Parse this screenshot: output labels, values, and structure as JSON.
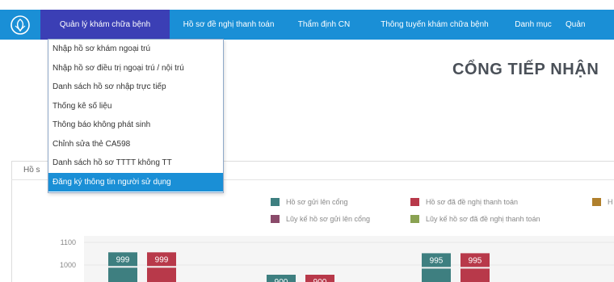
{
  "nav": {
    "items": [
      {
        "label": "Quản lý khám chữa bệnh",
        "active": true
      },
      {
        "label": "Hồ sơ đề nghị thanh toán",
        "active": false
      },
      {
        "label": "Thẩm định CN",
        "active": false
      },
      {
        "label": "Thông tuyến khám chữa bệnh",
        "active": false
      },
      {
        "label": "Danh mục",
        "active": false
      },
      {
        "label": "Quản",
        "active": false
      }
    ]
  },
  "dropdown": {
    "items": [
      {
        "label": "Nhập hồ sơ khám ngoại trú"
      },
      {
        "label": "Nhập hồ sơ điều trị ngoại trú / nội trú"
      },
      {
        "label": "Danh sách hồ sơ nhập trực tiếp"
      },
      {
        "label": "Thống kê số liệu"
      },
      {
        "label": "Thông báo không phát sinh"
      },
      {
        "label": "Chỉnh sửa thẻ CA598"
      },
      {
        "label": "Danh sách hồ sơ TTTT không TT"
      },
      {
        "label": "Đăng ký thông tin người sử dụng"
      }
    ]
  },
  "page": {
    "title": "CỔNG TIẾP NHẬN",
    "panel_tab": "Hồ s"
  },
  "chart_data": {
    "type": "bar",
    "legend": [
      {
        "name": "Hồ sơ gửi lên cổng",
        "color": "#3e7f80"
      },
      {
        "name": "Hồ sơ đã đề nghị thanh toán",
        "color": "#b8394a"
      },
      {
        "name": "H",
        "color": "#b0802c"
      },
      {
        "name": "Lũy kế hồ sơ gửi lên cổng",
        "color": "#8a4a6a"
      },
      {
        "name": "Lũy kế hồ sơ đã đề nghị thanh toán",
        "color": "#8aa252"
      }
    ],
    "y_ticks": [
      "1100",
      "1000"
    ],
    "ylim": [
      0,
      1100
    ],
    "series": [
      {
        "name": "Hồ sơ gửi lên cổng",
        "values": [
          999,
          900,
          995
        ]
      },
      {
        "name": "Hồ sơ đã đề nghị thanh toán",
        "values": [
          999,
          900,
          995
        ]
      }
    ],
    "data_labels": [
      "999",
      "999",
      "900",
      "900",
      "995",
      "995"
    ]
  }
}
